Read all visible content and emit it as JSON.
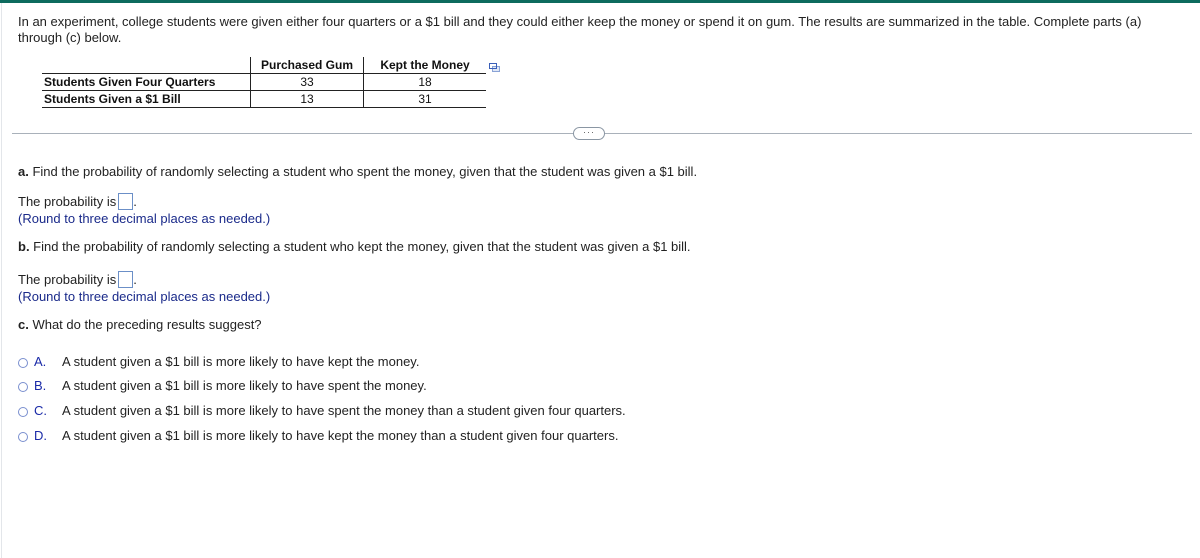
{
  "intro_text": "In an experiment, college students were given either four quarters or a $1 bill and they could either keep the money or spend it on gum. The results are summarized in the table. Complete parts (a) through (c) below.",
  "table": {
    "columns": [
      "Purchased Gum",
      "Kept the Money"
    ],
    "rows": [
      {
        "label": "Students Given Four Quarters",
        "values": [
          "33",
          "18"
        ]
      },
      {
        "label": "Students Given a $1 Bill",
        "values": [
          "13",
          "31"
        ]
      }
    ],
    "copy_icon": "copy-table-icon"
  },
  "more_button_label": "···",
  "part_a": {
    "letter": "a.",
    "question": " Find the probability of randomly selecting a student who spent the money, given that the student was given a $1 bill.",
    "prompt": "The probability is",
    "value": "",
    "suffix": ".",
    "hint": "(Round to three decimal places as needed.)"
  },
  "part_b": {
    "letter": "b.",
    "question": " Find the probability of randomly selecting a student who kept the money, given that the student was given a $1 bill.",
    "prompt": "The probability is",
    "value": "",
    "suffix": ".",
    "hint": "(Round to three decimal places as needed.)"
  },
  "part_c": {
    "letter": "c.",
    "question": " What do the preceding results suggest?",
    "options": [
      {
        "letter": "A.",
        "text": "A student given a $1 bill is more likely to have kept the money."
      },
      {
        "letter": "B.",
        "text": "A student given a $1 bill is more likely to have spent the money."
      },
      {
        "letter": "C.",
        "text": "A student given a $1 bill is more likely to have spent the money than a student given four quarters."
      },
      {
        "letter": "D.",
        "text": "A student given a $1 bill is more likely to have kept the money than a student given four quarters."
      }
    ]
  },
  "colors": {
    "top_bar": "#0d6b5e",
    "hint_text": "#1a2a8a",
    "option_letter": "#1a2aa8"
  }
}
